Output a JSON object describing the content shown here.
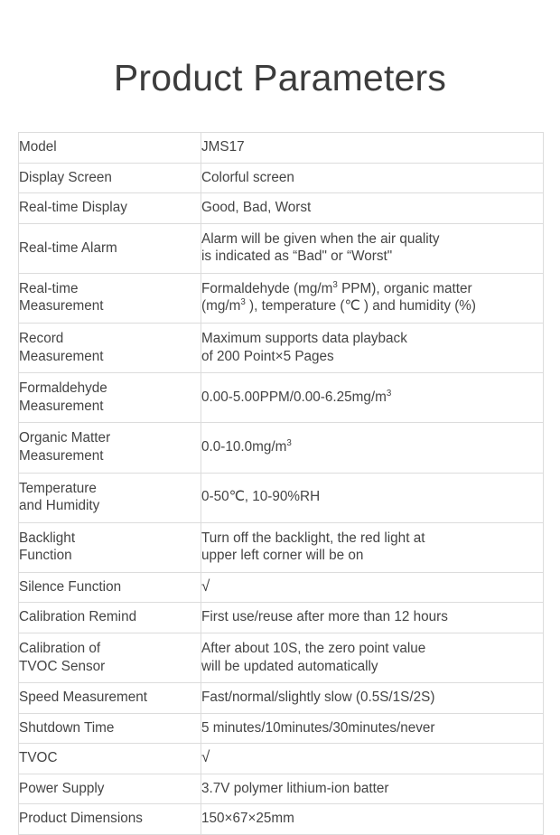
{
  "title": "Product Parameters",
  "table": {
    "rows": [
      {
        "name": "Model",
        "value_lines": [
          "JMS17"
        ],
        "two_line": false
      },
      {
        "name": "Display Screen",
        "value_lines": [
          "Colorful screen"
        ],
        "two_line": false
      },
      {
        "name": "Real-time Display",
        "value_lines": [
          "Good, Bad, Worst"
        ],
        "two_line": false
      },
      {
        "name": "Real-time Alarm",
        "value_lines": [
          "Alarm will be given when the air quality",
          "is indicated as “Bad\" or “Worst\""
        ],
        "two_line": true
      },
      {
        "name_lines": [
          "Real-time",
          "Measurement"
        ],
        "name": "Real-time Measurement",
        "value_html_lines": [
          "Formaldehyde (mg/m<sup>3</sup> PPM), organic matter",
          "(mg/m<sup>3</sup> ), temperature (℃ ) and humidity (%)"
        ],
        "two_line": true
      },
      {
        "name_lines": [
          "Record",
          "Measurement"
        ],
        "name": "Record Measurement",
        "value_lines": [
          "Maximum supports data playback",
          "of 200 Point×5 Pages"
        ],
        "two_line": true
      },
      {
        "name_lines": [
          "Formaldehyde",
          "Measurement"
        ],
        "name": "Formaldehyde Measurement",
        "value_html_lines": [
          "0.00-5.00PPM/0.00-6.25mg/m<sup>3</sup>"
        ],
        "two_line": true
      },
      {
        "name_lines": [
          "Organic Matter",
          "Measurement"
        ],
        "name": "Organic Matter Measurement",
        "value_html_lines": [
          "0.0-10.0mg/m<sup>3</sup>"
        ],
        "two_line": true
      },
      {
        "name_lines": [
          "Temperature",
          "and Humidity"
        ],
        "name": "Temperature and Humidity",
        "value_lines": [
          "0-50℃, 10-90%RH"
        ],
        "two_line": true
      },
      {
        "name_lines": [
          "Backlight",
          "Function"
        ],
        "name": "Backlight Function",
        "value_lines": [
          "Turn off the backlight, the red light at",
          "upper left corner will be on"
        ],
        "two_line": true
      },
      {
        "name": "Silence Function",
        "value_lines": [
          "√"
        ],
        "is_check": true,
        "two_line": false
      },
      {
        "name": "Calibration Remind",
        "value_lines": [
          "First use/reuse after more than 12 hours"
        ],
        "two_line": false
      },
      {
        "name_lines": [
          "Calibration of",
          "TVOC Sensor"
        ],
        "name": "Calibration of TVOC Sensor",
        "value_lines": [
          "After about 10S, the zero point value",
          "will be updated automatically"
        ],
        "two_line": true
      },
      {
        "name": "Speed Measurement",
        "value_lines": [
          "Fast/normal/slightly slow (0.5S/1S/2S)"
        ],
        "two_line": false
      },
      {
        "name": "Shutdown Time",
        "value_lines": [
          "5 minutes/10minutes/30minutes/never"
        ],
        "two_line": false
      },
      {
        "name": "TVOC",
        "value_lines": [
          "√"
        ],
        "is_check": true,
        "two_line": false
      },
      {
        "name": "Power Supply",
        "value_lines": [
          "3.7V polymer lithium-ion batter"
        ],
        "two_line": false
      },
      {
        "name": "Product Dimensions",
        "value_lines": [
          "150×67×25mm"
        ],
        "two_line": false
      }
    ]
  },
  "colors": {
    "text": "#444444",
    "title": "#3c3c3c",
    "border": "#dcdcdc",
    "background": "#ffffff"
  }
}
